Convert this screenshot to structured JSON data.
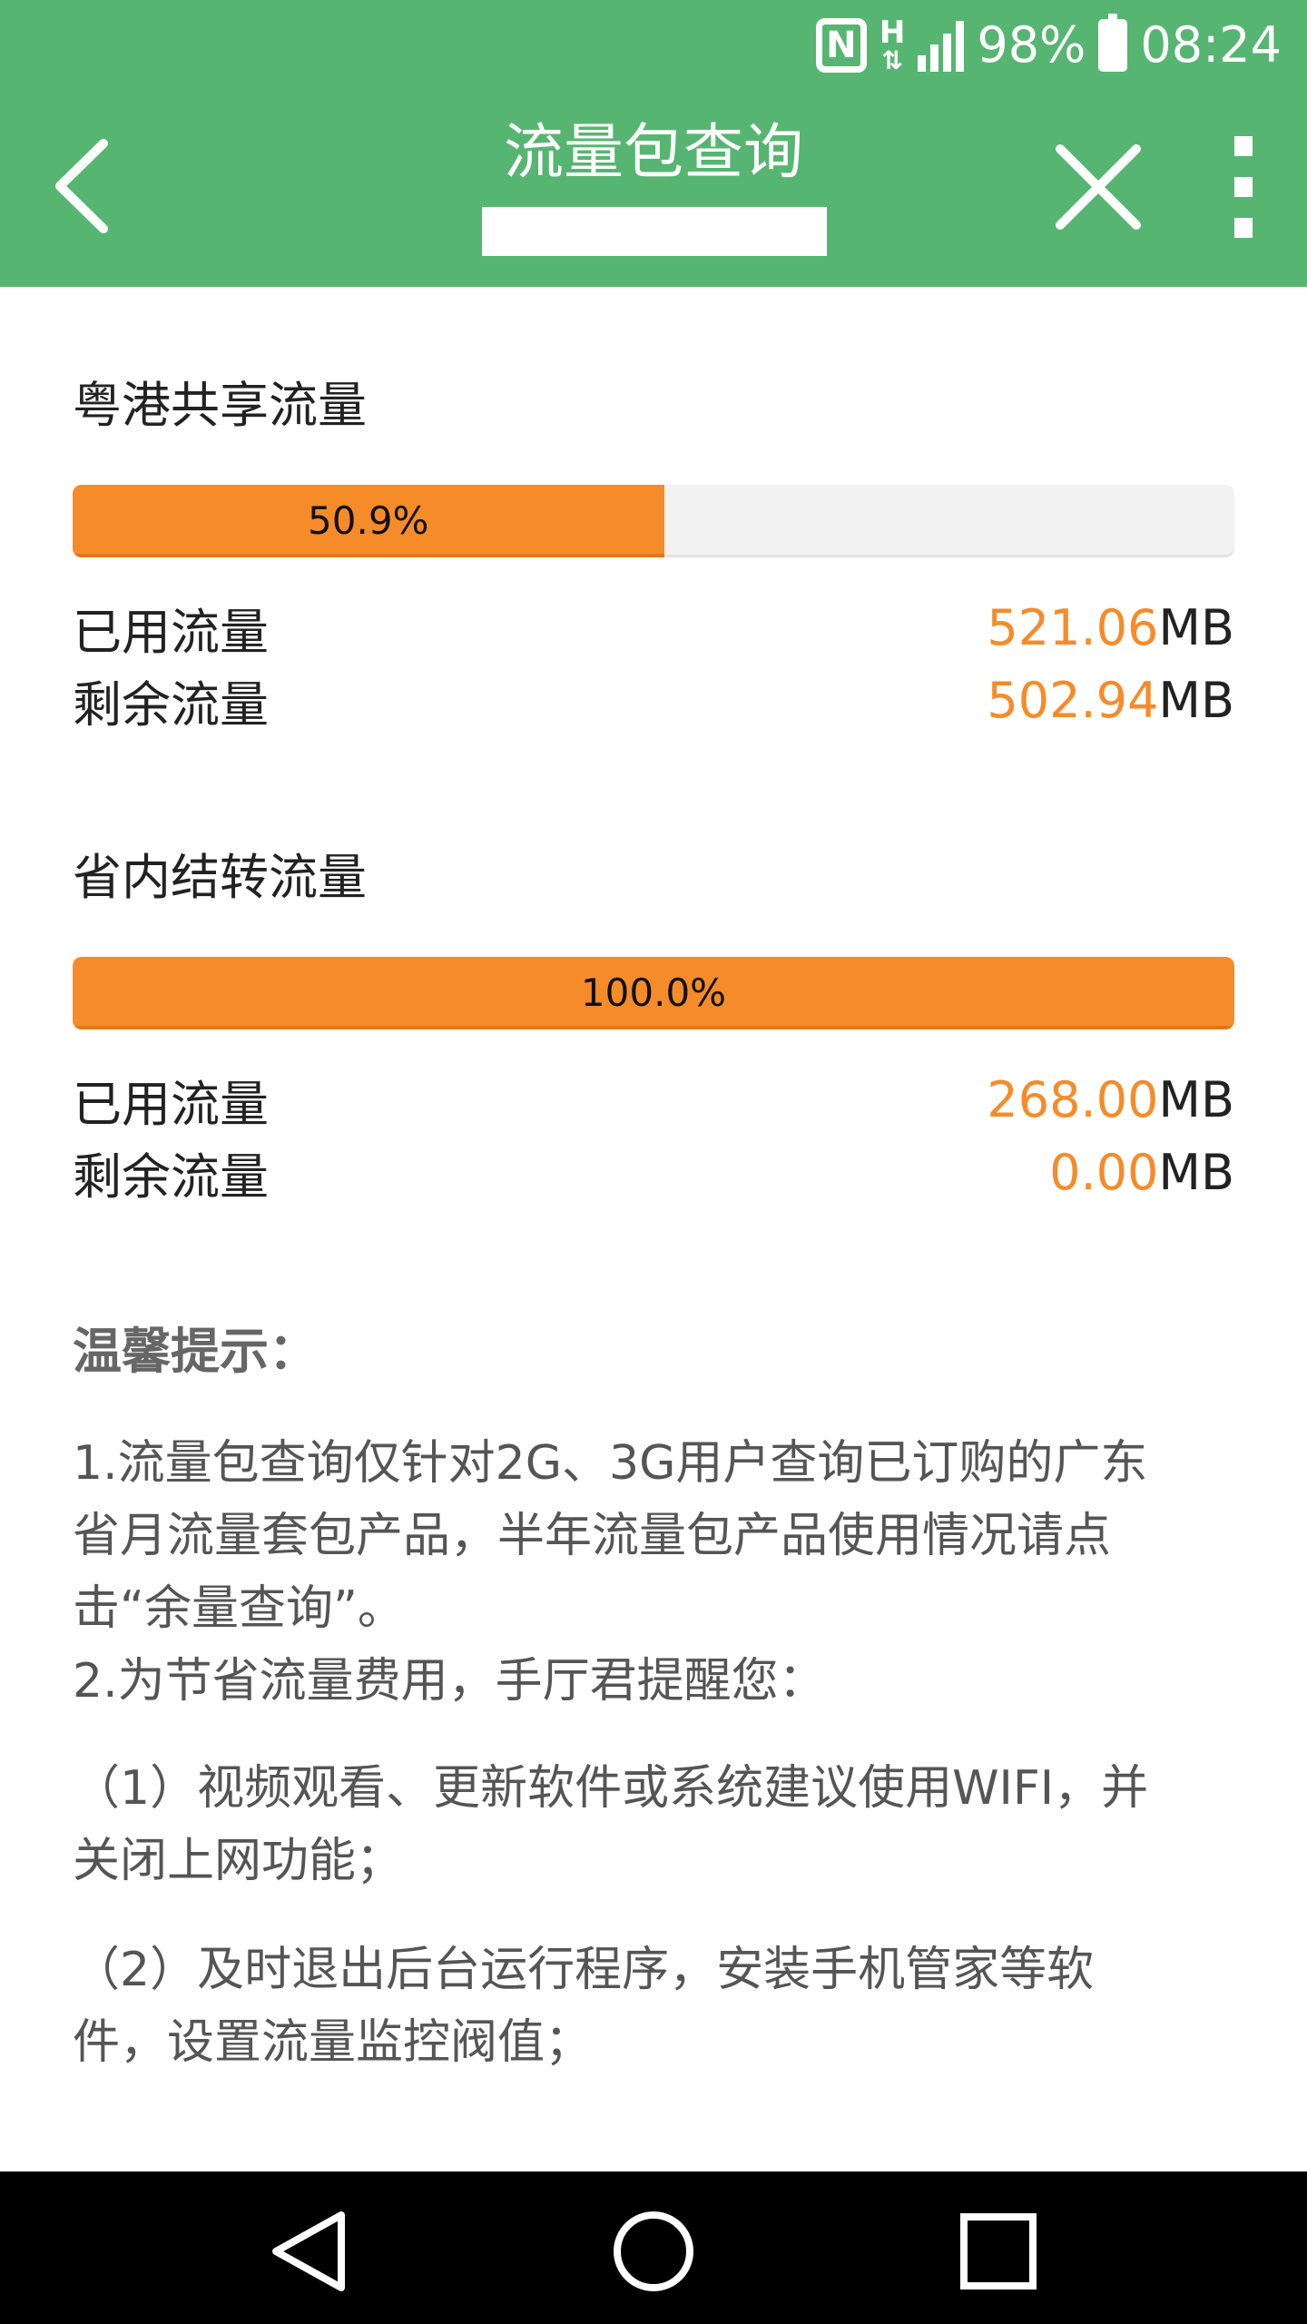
{
  "status_bar": {
    "nfc_icon": "nfc-icon",
    "network_type": "H",
    "signal_icon": "signal-icon",
    "battery_percent": "98%",
    "battery_icon": "battery-icon",
    "time": "08:24"
  },
  "header": {
    "title": "流量包查询",
    "back_icon": "back-arrow-icon",
    "close_icon": "close-icon",
    "more_icon": "more-vert-icon",
    "background_color": "#57b572"
  },
  "sections": [
    {
      "title": "粤港共享流量",
      "progress_label": "50.9%",
      "progress": 0.509,
      "used_label": "已用流量",
      "used_value": "521.06",
      "used_unit": "MB",
      "remaining_label": "剩余流量",
      "remaining_value": "502.94",
      "remaining_unit": "MB"
    },
    {
      "title": "省内结转流量",
      "progress_label": "100.0%",
      "progress": 1.0,
      "used_label": "已用流量",
      "used_value": "268.00",
      "used_unit": "MB",
      "remaining_label": "剩余流量",
      "remaining_value": "0.00",
      "remaining_unit": "MB"
    }
  ],
  "tips": {
    "title": "温馨提示：",
    "p1": [
      "1.流量包查询仅针对2G、3G用户查询已订购的广东",
      "省月流量套包产品，半年流量包产品使用情况请点",
      "击“余量查询”。"
    ],
    "p2": "2.为节省流量费用，手厅君提醒您：",
    "p3": [
      "（1）视频观看、更新软件或系统建议使用WIFI，并",
      "关闭上网功能；"
    ],
    "p4": [
      "（2）及时退出后台运行程序，安装手机管家等软",
      "件，设置流量监控阀值；"
    ]
  },
  "colors": {
    "accent": "#f68b29",
    "header": "#57b572",
    "bar_track": "#f2f2f2"
  },
  "system_nav": {
    "back_icon": "nav-back-triangle-icon",
    "home_icon": "nav-home-circle-icon",
    "recents_icon": "nav-recents-square-icon"
  }
}
